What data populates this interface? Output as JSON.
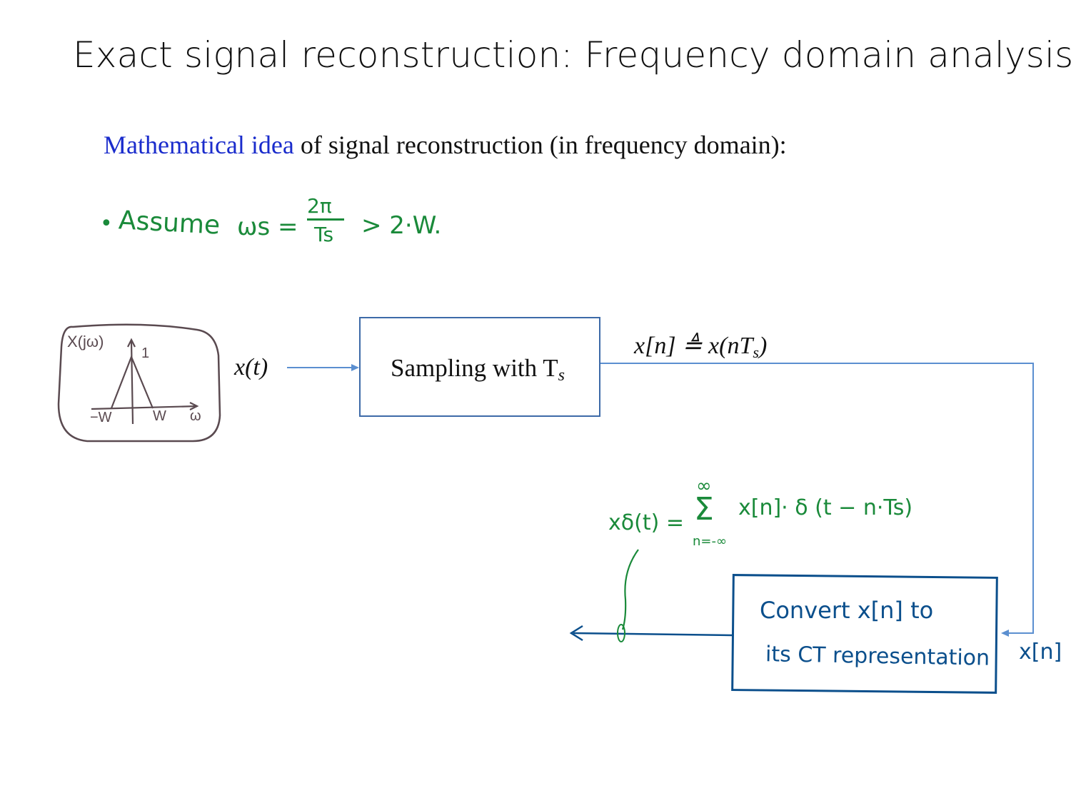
{
  "title": "Exact signal reconstruction: Frequency domain analysis",
  "subtitle": {
    "accent": "Mathematical idea",
    "rest": " of signal reconstruction (in frequency domain):"
  },
  "assumption": {
    "bullet": "•",
    "word": "Assume",
    "lhs": "ωs =",
    "numerator": "2π",
    "denominator": "Ts",
    "rhs": "> 2·W."
  },
  "spectrum_sketch": {
    "func_label": "X(jω)",
    "peak_label": "1",
    "neg_w": "−W",
    "pos_w": "W",
    "omega": "ω"
  },
  "diagram": {
    "input_label": "x(t)",
    "sampling_box_label": "Sampling with T",
    "sampling_box_sub": "s",
    "sample_eq": "x[n] ≜ x(nT",
    "sample_eq_sub": "s",
    "sample_eq_end": ")",
    "xn_side_label": "x[n]",
    "convert_line1": "Convert x[n] to",
    "convert_line2": "its CT representation",
    "impulse_lhs": "xδ(t) =",
    "impulse_sum_top": "∞",
    "impulse_sum": "Σ",
    "impulse_sum_bottom": "n=-∞",
    "impulse_rhs": "x[n]· δ (t − n·Ts)"
  },
  "colors": {
    "accent_blue": "#1a2ccc",
    "hand_green": "#1a8a3a",
    "hand_blue": "#0b4f8c",
    "diagram_line": "#5b8fd0"
  }
}
